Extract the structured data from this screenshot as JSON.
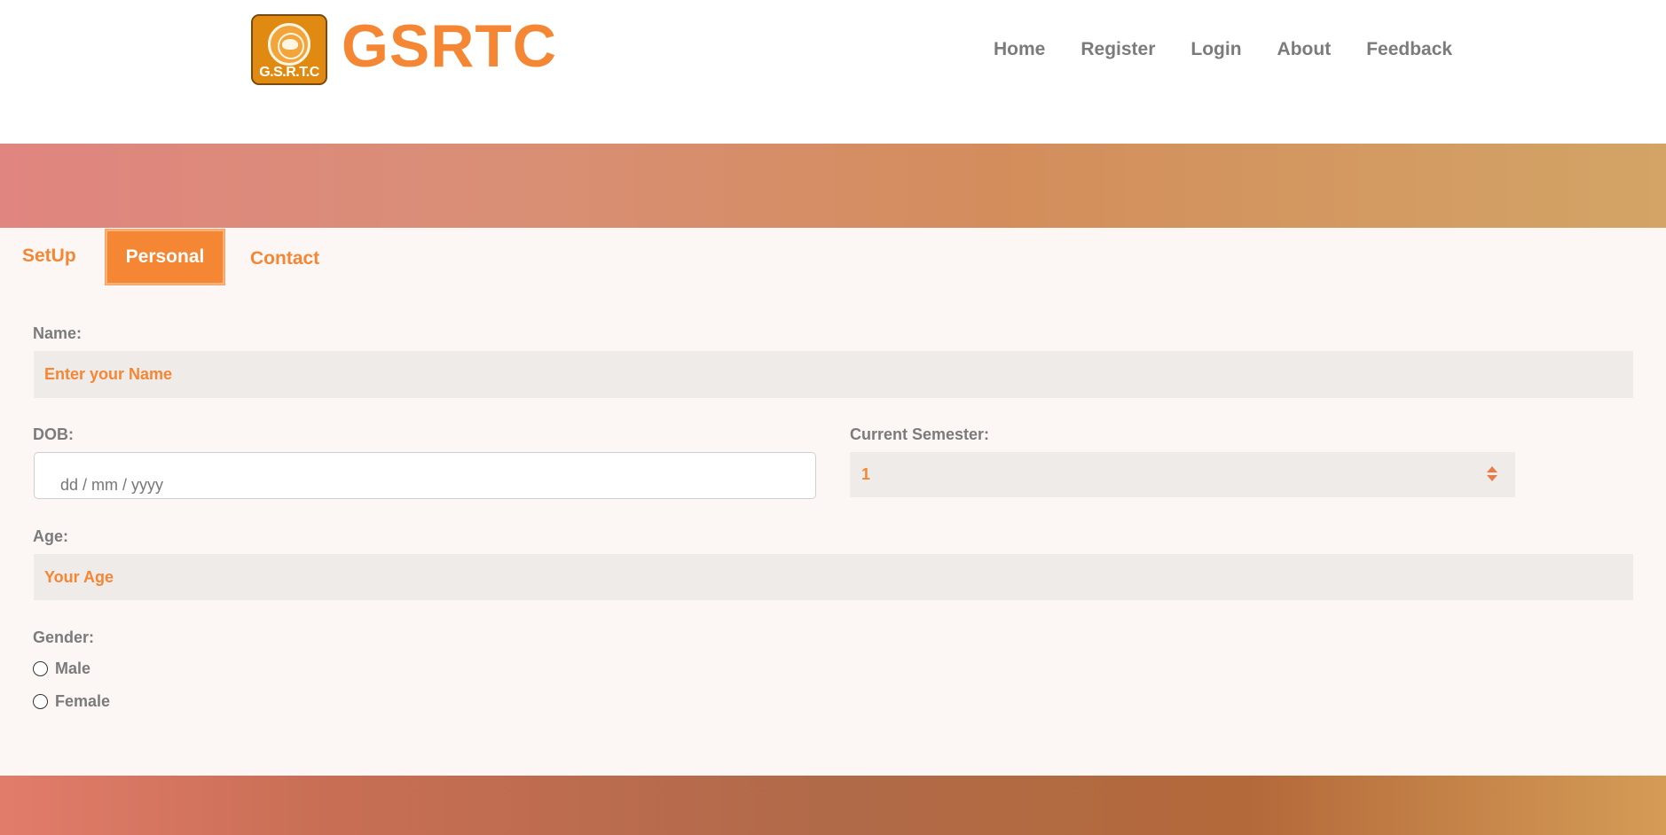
{
  "header": {
    "logo_text": "G.S.R.T.C",
    "brand": "GSRTC",
    "nav": [
      "Home",
      "Register",
      "Login",
      "About",
      "Feedback"
    ]
  },
  "tabs": {
    "setup": "SetUp",
    "personal": "Personal",
    "contact": "Contact"
  },
  "form": {
    "name_label": "Name:",
    "name_placeholder": "Enter your Name",
    "dob_label": "DOB:",
    "dob_placeholder": "dd / mm / yyyy",
    "semester_label": "Current Semester:",
    "semester_value": "1",
    "age_label": "Age:",
    "age_placeholder": "Your Age",
    "gender_label": "Gender:",
    "gender_options": [
      "Male",
      "Female"
    ]
  },
  "colors": {
    "accent": "#f48634",
    "label": "#7b7b7b",
    "field_bg": "#efebe8"
  }
}
